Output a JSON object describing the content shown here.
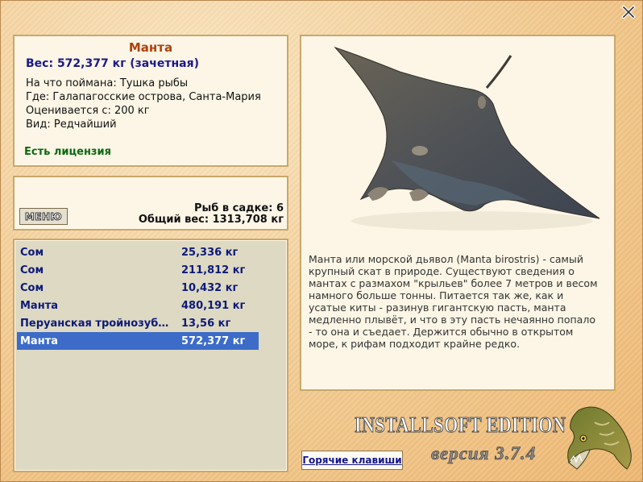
{
  "fish": {
    "title": "Манта",
    "weight_line": "Вес: 572,377 кг (зачетная)",
    "bait": "На что поймана: Тушка рыбы",
    "location": "Где: Галапагосские острова, Санта-Мария",
    "rated_from": "Оценивается с: 200 кг",
    "kind": "Вид: Редчайший",
    "license": "Есть лицензия"
  },
  "keepnet": {
    "menu_label": "МЕНЮ",
    "count": "Рыб в садке: 6",
    "total_weight": "Общий вес: 1313,708 кг"
  },
  "catch_list": [
    {
      "name": "Сом",
      "weight": "25,336 кг",
      "selected": false
    },
    {
      "name": "Сом",
      "weight": "211,812 кг",
      "selected": false
    },
    {
      "name": "Сом",
      "weight": "10,432 кг",
      "selected": false
    },
    {
      "name": "Манта",
      "weight": "480,191 кг",
      "selected": false
    },
    {
      "name": "Перуанская тройнозуб…",
      "weight": "13,56 кг",
      "selected": false
    },
    {
      "name": "Манта",
      "weight": "572,377 кг",
      "selected": true
    }
  ],
  "description": "Манта или морской дьявол (Manta birostris) - самый крупный скат в природе. Существуют сведения о мантах с размахом \"крыльев\" более 7 метров и весом намного больше тонны. Питается так же, как и усатые киты - разинув гигантскую пасть, манта медленно плывёт, и что в эту пасть нечаянно попало - то она и съедает. Держится обычно в открытом море, к рифам подходит крайне редко.",
  "branding": {
    "edition": "INSTALLSOFT EDITION",
    "version": "версия 3.7.4"
  },
  "hotkeys_label": "Горячие клавиши",
  "icons": {
    "close": "close-icon",
    "fish_image": "manta-ray-image",
    "logo": "pike-logo"
  },
  "colors": {
    "title": "#b0400c",
    "weight": "#1a1a8a",
    "license": "#0a6a10",
    "selection": "#3c6cc8"
  }
}
